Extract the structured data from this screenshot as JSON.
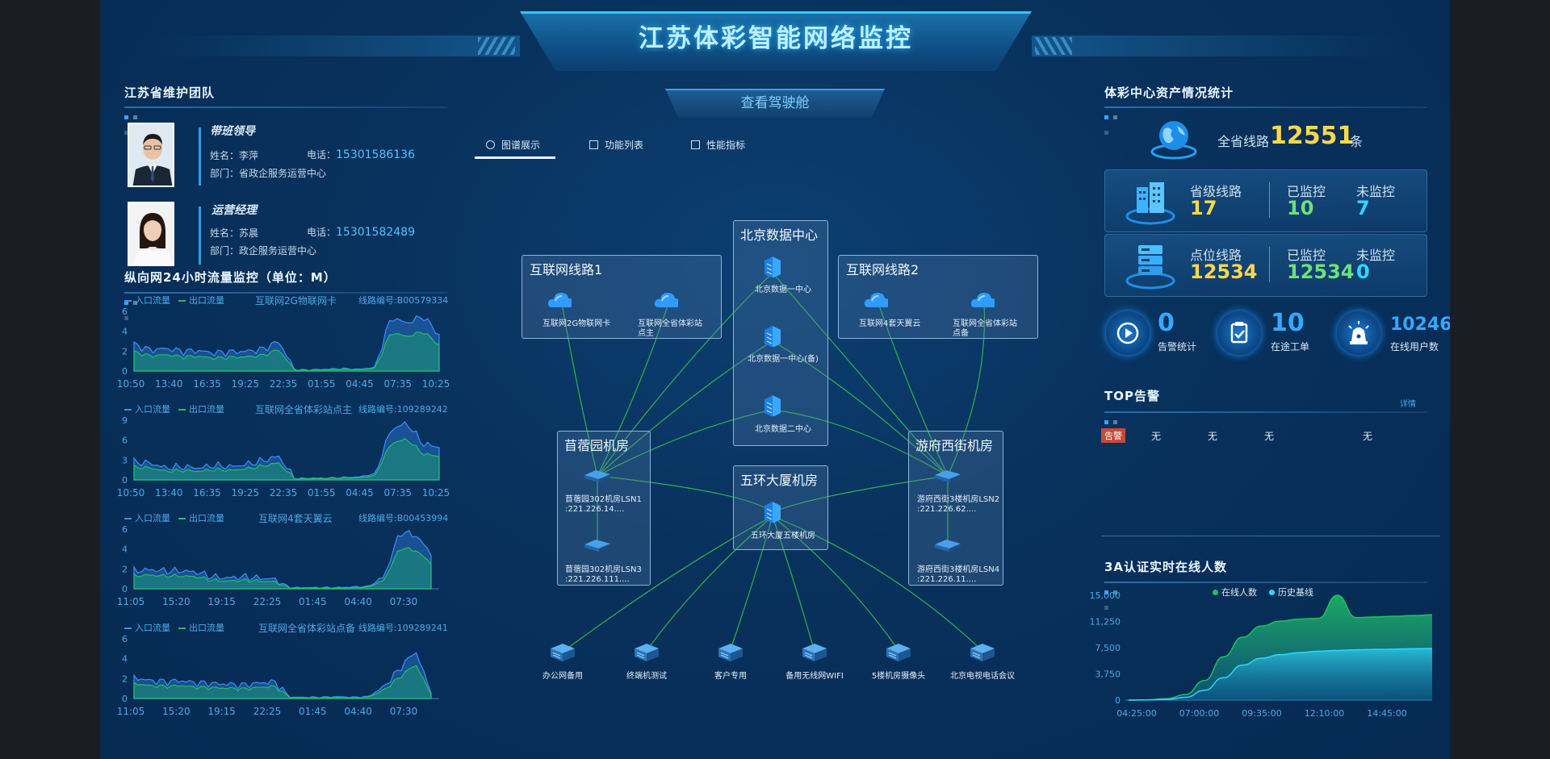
{
  "header": {
    "title": "江苏体彩智能网络监控",
    "cockpit_label": "查看驾驶舱"
  },
  "colors": {
    "accent": "#2ab4ff",
    "in_flow": "#3a8fff",
    "out_flow": "#20c060",
    "yellow": "#ffd84a",
    "green": "#6fe07a",
    "cyan": "#2fd6ff",
    "alarm": "#c74a36"
  },
  "team": {
    "title": "江苏省维护团队",
    "members": [
      {
        "role": "带班领导",
        "name": "姓名：李萍",
        "phone_label": "电话：",
        "phone": "15301586136",
        "dept": "部门：省政企服务运营中心"
      },
      {
        "role": "运营经理",
        "name": "姓名：苏晨",
        "phone_label": "电话：",
        "phone": "15301582489",
        "dept": "部门：政企服务运营中心"
      }
    ]
  },
  "traffic": {
    "title": "纵向网24小时流量监控（单位：M）",
    "legend_in": "入口流量",
    "legend_out": "出口流量",
    "charts": [
      {
        "name": "互联网2G物联网卡",
        "code": "线路编号:B00579334",
        "yticks": [
          "6",
          "4",
          "2",
          "0"
        ],
        "xticks": [
          "10:50",
          "13:40",
          "16:35",
          "19:25",
          "22:35",
          "01:55",
          "04:45",
          "07:35",
          "10:25"
        ]
      },
      {
        "name": "互联网全省体彩站点主",
        "code": "线路编号:109289242",
        "yticks": [
          "9",
          "6",
          "3",
          "0"
        ],
        "xticks": [
          "10:50",
          "13:40",
          "16:35",
          "19:25",
          "22:35",
          "01:55",
          "04:45",
          "07:35",
          "10:25"
        ]
      },
      {
        "name": "互联网4套天翼云",
        "code": "线路编号:B00453994",
        "yticks": [
          "6",
          "4",
          "2",
          "0"
        ],
        "xticks": [
          "11:05",
          "15:20",
          "19:15",
          "22:25",
          "01:45",
          "04:40",
          "07:30"
        ]
      },
      {
        "name": "互联网全省体彩站点备",
        "code": "线路编号:109289241",
        "yticks": [
          "6",
          "4",
          "2",
          "0"
        ],
        "xticks": [
          "11:05",
          "15:20",
          "19:15",
          "22:25",
          "01:45",
          "04:40",
          "07:30"
        ]
      }
    ]
  },
  "tabs": [
    {
      "label": "图谱展示"
    },
    {
      "label": "功能列表"
    },
    {
      "label": "性能指标"
    }
  ],
  "topology": {
    "boxes": {
      "internet1": "互联网线路1",
      "beijing": "北京数据中心",
      "internet2": "互联网线路2",
      "muxuyuan": "苜蓿园机房",
      "wuhuan": "五环大厦机房",
      "youfu": "游府西街机房"
    },
    "nodes": {
      "cloud_2g": "互联网2G物联网卡",
      "cloud_main": [
        "互联网全省体彩站",
        "点主"
      ],
      "cloud_tianyi": "互联网4套天翼云",
      "cloud_backup": [
        "互联网全省体彩站",
        "点备"
      ],
      "bj1": "北京数据一中心",
      "bj1b": "北京数据一中心(备)",
      "bj2": "北京数据二中心",
      "mx1": [
        "苜蓿园302机房LSN1",
        ":221.226.14...."
      ],
      "mx3": [
        "苜蓿园302机房LSN3",
        ":221.226.111...."
      ],
      "wh": "五环大厦五楼机房",
      "yf2": [
        "游府西街3楼机房LSN2",
        ":221.226.62...."
      ],
      "yf4": [
        "游府西街3楼机房LSN4",
        ":221.226.11...."
      ],
      "office": "办公网备用",
      "terminal": "终端机测试",
      "customer": "客户专用",
      "wifi": "备用无线网WIFI",
      "camera": "5楼机房摄像头",
      "bjtv": "北京电视电话会议"
    }
  },
  "assets": {
    "title": "体彩中心资产情况统计",
    "total_label": "全省线路",
    "total": "12551",
    "total_unit": "条",
    "monitored_label": "已监控",
    "unmonitored_label": "未监控",
    "rows": [
      {
        "label": "省级线路",
        "value": "17",
        "monitored": "10",
        "unmonitored": "7"
      },
      {
        "label": "点位线路",
        "value": "12534",
        "monitored": "12534",
        "unmonitored": "0"
      }
    ],
    "kpis": [
      {
        "value": "0",
        "label": "告警统计",
        "icon": "play-icon"
      },
      {
        "value": "10",
        "label": "在途工单",
        "icon": "clipboard-icon"
      },
      {
        "value": "10246",
        "label": "在线用户数",
        "icon": "alarm-lamp-icon"
      }
    ]
  },
  "top_alarm": {
    "title": "TOP告警",
    "detail": "详情",
    "tag": "告警",
    "values": [
      "无",
      "无",
      "无",
      "无"
    ]
  },
  "auth": {
    "title": "3A认证实时在线人数",
    "legend": [
      "在线人数",
      "历史基线"
    ],
    "chart_data": {
      "type": "area",
      "yticks": [
        "15,000",
        "11,250",
        "7,500",
        "3,750",
        "0"
      ],
      "xticks": [
        "04:25:00",
        "07:00:00",
        "09:35:00",
        "12:10:00",
        "14:45:00"
      ],
      "ylim": [
        0,
        15000
      ],
      "series": [
        {
          "name": "在线人数",
          "values": [
            0,
            50,
            200,
            800,
            2800,
            6200,
            9000,
            10600,
            11300,
            11600,
            11700,
            15000,
            11800,
            11900,
            12000,
            12100,
            12200
          ]
        },
        {
          "name": "历史基线",
          "values": [
            0,
            30,
            100,
            400,
            1400,
            3200,
            5000,
            6000,
            6500,
            6800,
            7000,
            7100,
            7200,
            7250,
            7300,
            7350,
            7400
          ]
        }
      ]
    }
  }
}
